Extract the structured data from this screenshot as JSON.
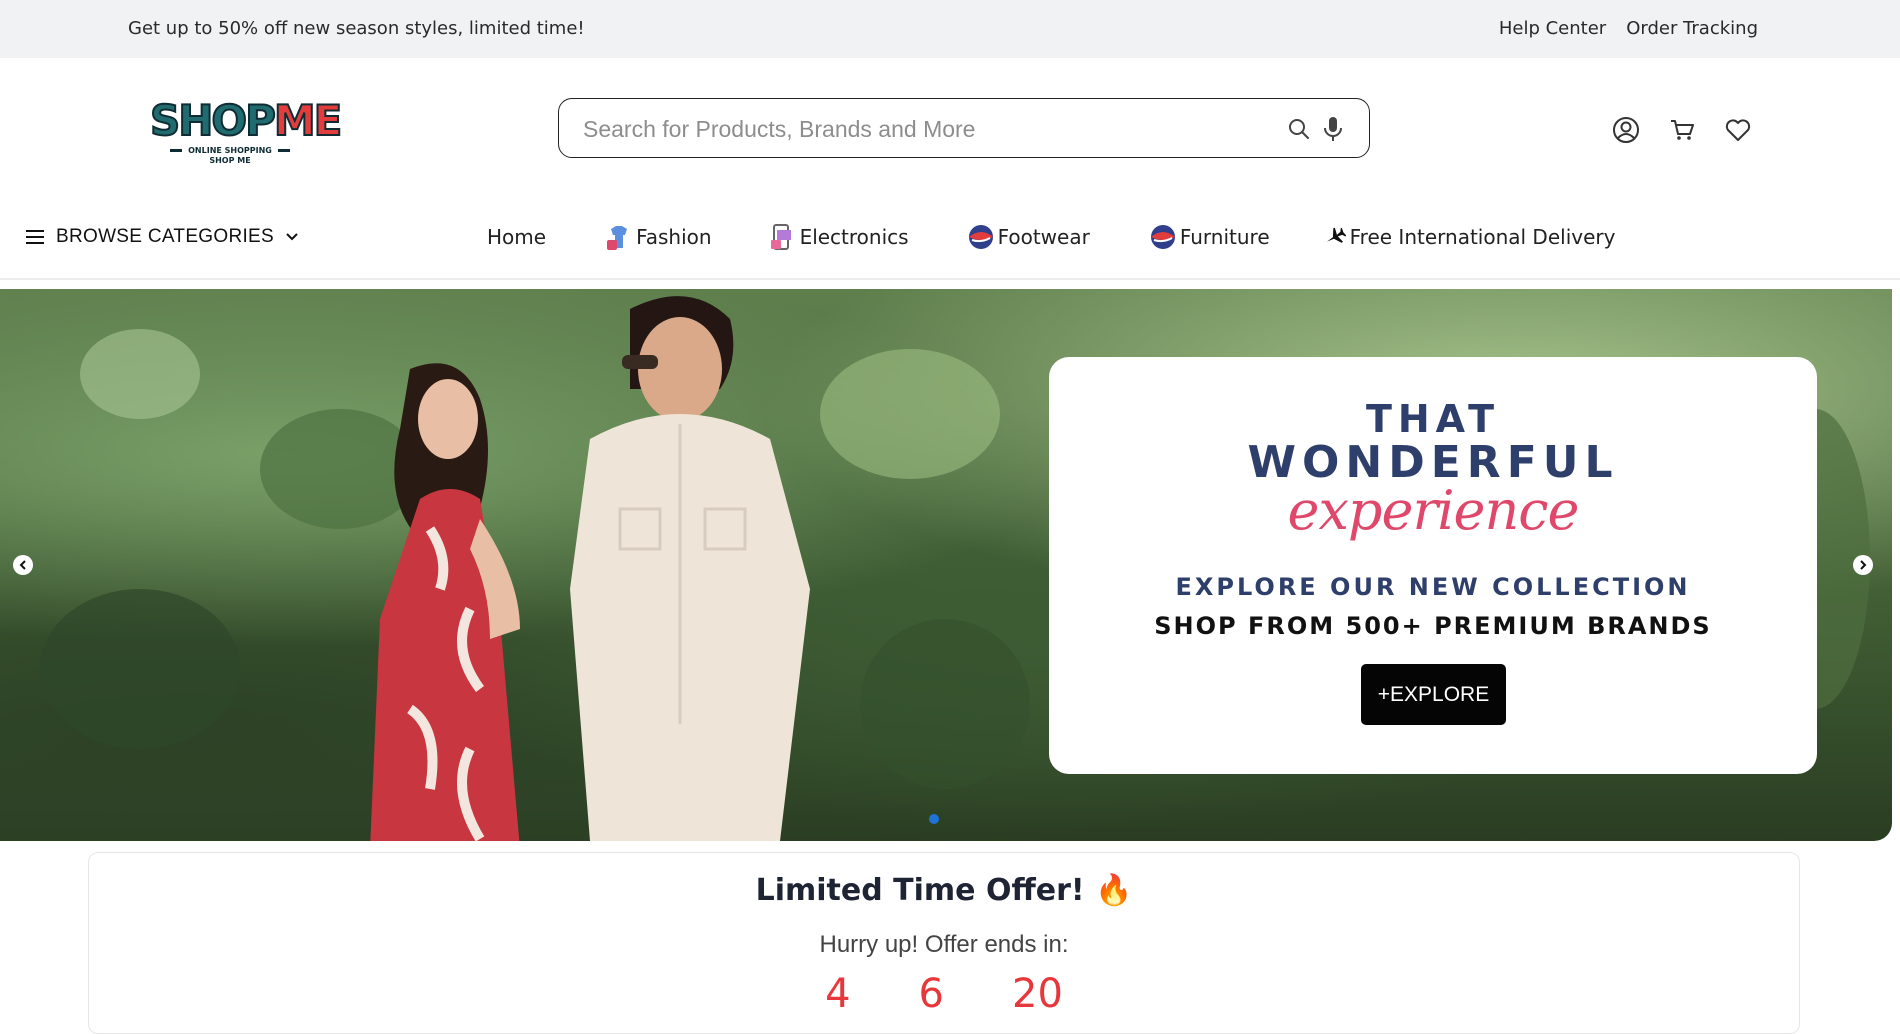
{
  "topbar": {
    "promo": "Get up to 50% off new season styles, limited time!",
    "links": [
      "Help Center",
      "Order Tracking"
    ]
  },
  "logo": {
    "text_left": "SHOP",
    "text_right": "ME",
    "tagline_1": "ONLINE SHOPPING",
    "tagline_2": "SHOP ME"
  },
  "search": {
    "placeholder": "Search for Products, Brands and More",
    "value": "",
    "icons": [
      "search-icon",
      "microphone-icon"
    ]
  },
  "header_icons": [
    "user-icon",
    "cart-icon",
    "heart-icon"
  ],
  "browse": {
    "label": "BROWSE CATEGORIES"
  },
  "nav": {
    "items": [
      {
        "label": "Home",
        "icon": ""
      },
      {
        "label": "Fashion",
        "icon": "fashion-icon"
      },
      {
        "label": "Electronics",
        "icon": "electronics-icon"
      },
      {
        "label": "Footwear",
        "icon": "footwear-icon"
      },
      {
        "label": "Furniture",
        "icon": "furniture-icon"
      },
      {
        "label": "Free International Delivery",
        "icon": "airplane-icon"
      }
    ]
  },
  "hero": {
    "line1": "THAT",
    "line2": "WONDERFUL",
    "line3": "experience",
    "line4": "EXPLORE OUR NEW COLLECTION",
    "line5": "SHOP FROM 500+ PREMIUM BRANDS",
    "cta": "+EXPLORE",
    "colors": {
      "navy": "#2f3f6b",
      "pink": "#e0486b"
    },
    "active_slide": 1
  },
  "offer": {
    "title": "Limited Time Offer!",
    "emoji": "🔥",
    "subtitle": "Hurry up! Offer ends in:",
    "counts": [
      "4",
      "6",
      "20"
    ],
    "count_color": "#e8373b"
  }
}
